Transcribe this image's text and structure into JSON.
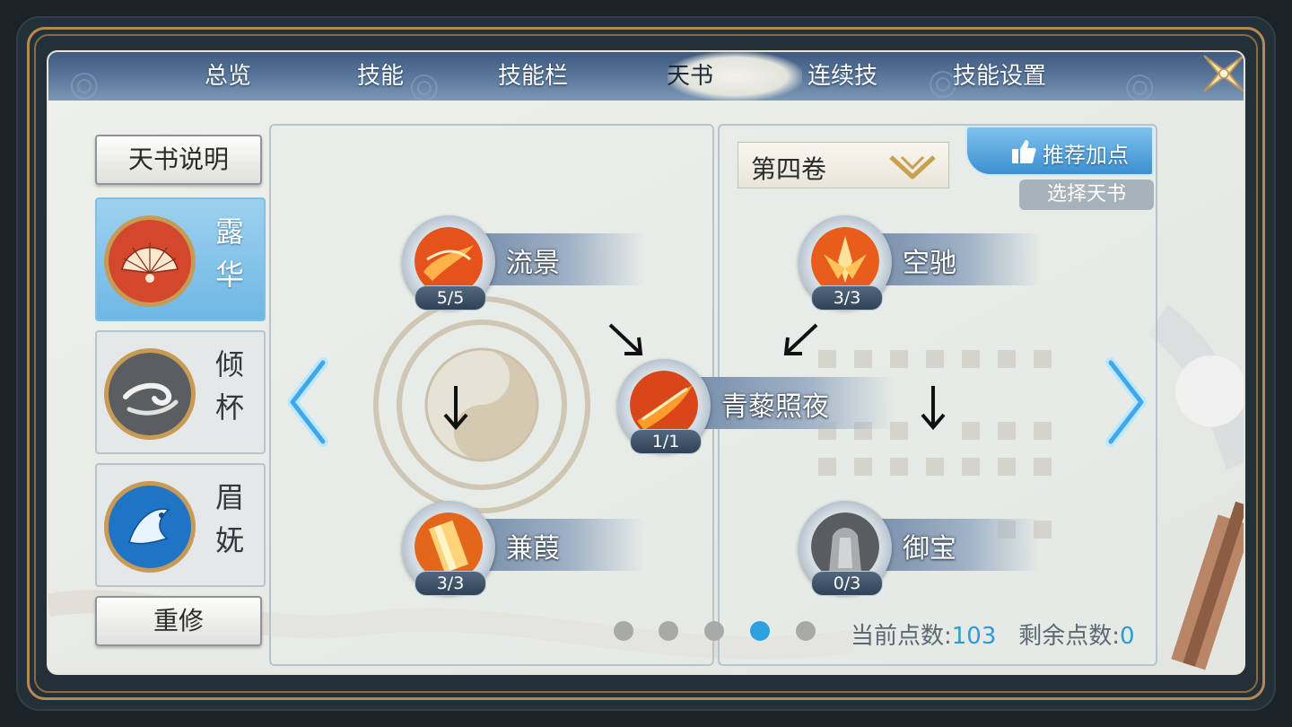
{
  "tabs": [
    {
      "label": "总览"
    },
    {
      "label": "技能"
    },
    {
      "label": "技能栏"
    },
    {
      "label": "天书",
      "active": true
    },
    {
      "label": "连续技"
    },
    {
      "label": "技能设置"
    }
  ],
  "sidebar": {
    "explain_label": "天书说明",
    "books": [
      {
        "name_top": "露",
        "name_bottom": "华",
        "active": true,
        "icon": "fan-icon"
      },
      {
        "name_top": "倾",
        "name_bottom": "杯",
        "active": false,
        "icon": "wind-swirl-icon"
      },
      {
        "name_top": "眉",
        "name_bottom": "妩",
        "active": false,
        "icon": "phoenix-icon"
      }
    ],
    "reset_label": "重修"
  },
  "volume": {
    "label": "第四卷"
  },
  "recommend_label": "推荐加点",
  "choose_label": "选择天书",
  "skills": [
    {
      "name": "流景",
      "level": "5/5"
    },
    {
      "name": "兼葭",
      "level": "3/3"
    },
    {
      "name": "青藜照夜",
      "level": "1/1"
    },
    {
      "name": "空驰",
      "level": "3/3"
    },
    {
      "name": "御宝",
      "level": "0/3"
    }
  ],
  "page_dots": {
    "count": 5,
    "active_index": 3
  },
  "points": {
    "current_label": "当前点数:",
    "current_value": "103",
    "remaining_label": "剩余点数:",
    "remaining_value": "0"
  },
  "colors": {
    "accent": "#2ea2e0",
    "gold": "#b58a52",
    "tabbar": "#4f6d93"
  }
}
